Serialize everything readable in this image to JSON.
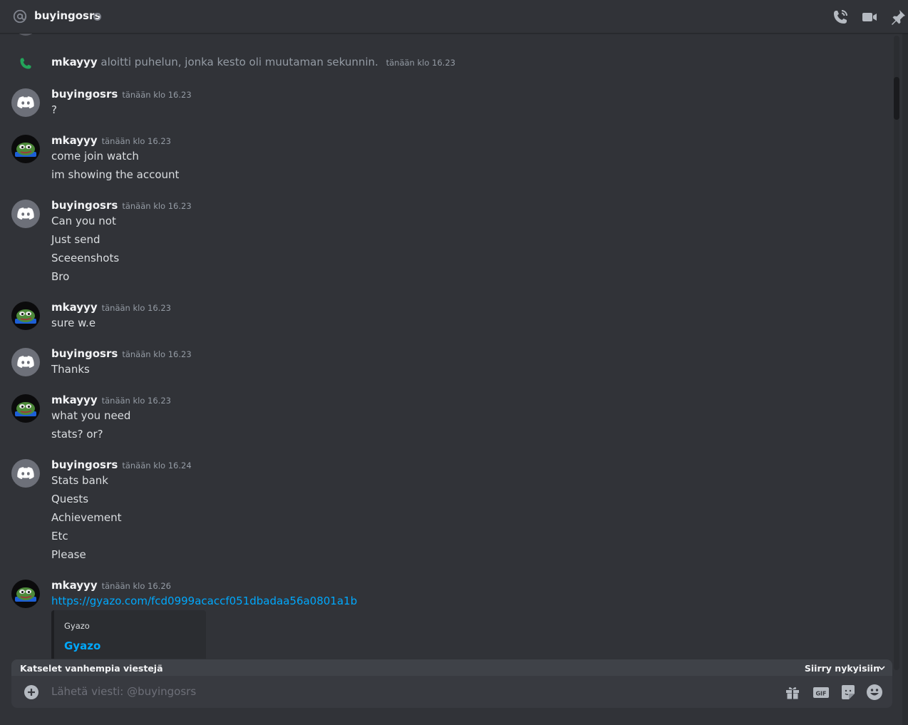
{
  "header": {
    "channel_name": "buyingosrs",
    "icons": [
      "at-icon",
      "status-offline-icon",
      "call-icon",
      "video-icon",
      "pin-icon"
    ]
  },
  "messages": {
    "m0": {
      "user": "mkayyy",
      "text": "aloitti puhelun, jonka kesto oli muutaman sekunnin.",
      "time": "tänään klo 16.23"
    },
    "m1": {
      "user": "buyingosrs",
      "time": "tänään klo 16.23",
      "lines": [
        "?"
      ]
    },
    "m2": {
      "user": "mkayyy",
      "time": "tänään klo 16.23",
      "lines": [
        "come join watch",
        "im showing the account"
      ]
    },
    "m3": {
      "user": "buyingosrs",
      "time": "tänään klo 16.23",
      "lines": [
        "Can you not",
        "Just send",
        "Sceeenshots",
        "Bro"
      ]
    },
    "m4": {
      "user": "mkayyy",
      "time": "tänään klo 16.23",
      "lines": [
        "sure w.e"
      ]
    },
    "m5": {
      "user": "buyingosrs",
      "time": "tänään klo 16.23",
      "lines": [
        "Thanks"
      ]
    },
    "m6": {
      "user": "mkayyy",
      "time": "tänään klo 16.23",
      "lines": [
        "what you need",
        "stats? or?"
      ]
    },
    "m7": {
      "user": "buyingosrs",
      "time": "tänään klo 16.24",
      "lines": [
        "Stats bank",
        "Quests",
        "Achievement",
        "Etc",
        "Please"
      ]
    },
    "m8": {
      "user": "mkayyy",
      "time": "tänään klo 16.26",
      "link": "https://gyazo.com/fcd0999acaccf051dbadaa56a0801a1b",
      "embed": {
        "provider": "Gyazo",
        "title": "Gyazo"
      }
    }
  },
  "banner": {
    "text": "Katselet vanhempia viestejä",
    "jump_label": "Siirry nykyisiin"
  },
  "composer": {
    "placeholder": "Lähetä viesti: @buyingosrs"
  },
  "colors": {
    "background": "#313338",
    "link": "#00a8fc",
    "call_green": "#23a55a"
  }
}
